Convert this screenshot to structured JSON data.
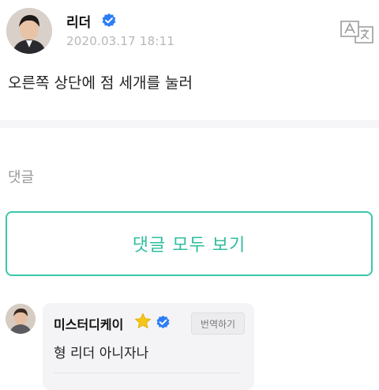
{
  "post": {
    "author": "리더",
    "date": "2020.03.17 18:11",
    "text": "오른쪽 상단에 점 세개를 눌러"
  },
  "comments_section": {
    "heading": "댓글",
    "view_all_label": "댓글 모두 보기"
  },
  "comment": {
    "author": "미스터디케이",
    "translate_label": "번역하기",
    "text": "형 리더 아니자나"
  },
  "colors": {
    "accent": "#3cc8a9",
    "verified": "#2d7df6",
    "star": "#f5c518"
  },
  "icons": [
    "verified-badge-icon",
    "translate-icon",
    "star-icon"
  ]
}
